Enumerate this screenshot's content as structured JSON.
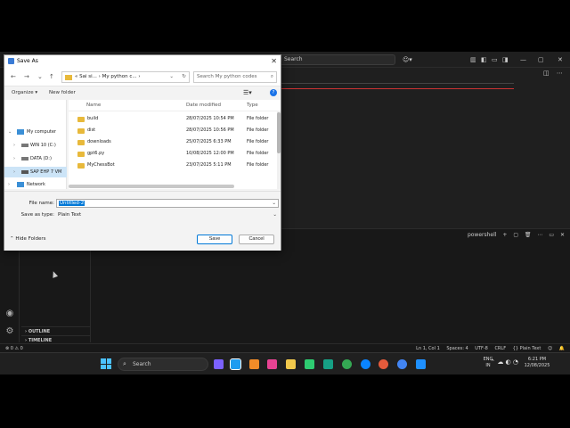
{
  "vscode": {
    "search_placeholder": "Search",
    "sections": {
      "outline": "OUTLINE",
      "timeline": "TIMELINE"
    },
    "panel_tabs": [
      "powershell",
      "+",
      "▢",
      "🗑",
      "⋯",
      "▭",
      "✕"
    ],
    "status_left": "⊗ 0 ⚠ 0",
    "status_right": [
      "Ln 1, Col 1",
      "Spaces: 4",
      "UTF-8",
      "CRLF",
      "{} Plain Text",
      "☺",
      "🔔"
    ]
  },
  "dialog": {
    "title": "Save As",
    "address_path": "« Sai si...  ›  My python c...  ›",
    "search_placeholder": "Search My python codes",
    "organize_label": "Organize ▾",
    "new_folder_label": "New folder",
    "nav_items": [
      {
        "label": "My computer",
        "expanded": true
      },
      {
        "label": "WIN 10 (C:)"
      },
      {
        "label": "DATA (D:)"
      },
      {
        "label": "SAP EHP 7 VM",
        "selected": true
      },
      {
        "label": "Network"
      }
    ],
    "columns": {
      "name": "Name",
      "date": "Date modified",
      "type": "Type"
    },
    "files": [
      {
        "name": "build",
        "date": "28/07/2025 10:54 PM",
        "type": "File folder",
        "kind": "folder"
      },
      {
        "name": "dist",
        "date": "28/07/2025 10:56 PM",
        "type": "File folder",
        "kind": "folder"
      },
      {
        "name": "downloads",
        "date": "25/07/2025 6:33 PM",
        "type": "File folder",
        "kind": "folder"
      },
      {
        "name": "gpt6.py",
        "date": "10/08/2025 12:00 PM",
        "type": "File folder",
        "kind": "folder"
      },
      {
        "name": "MyChessBot",
        "date": "23/07/2025 5:11 PM",
        "type": "File folder",
        "kind": "folder"
      }
    ],
    "file_name_label": "File name:",
    "file_name_value": "Untitled-2",
    "save_as_type_label": "Save as type:",
    "save_as_type_value": "Plain Text",
    "hide_folders_label": "Hide Folders",
    "save_label": "Save",
    "cancel_label": "Cancel"
  },
  "taskbar": {
    "search_placeholder": "Search",
    "lang_line1": "ENG",
    "lang_line2": "IN",
    "time": "6:21 PM",
    "date": "12/08/2025"
  },
  "colors": {
    "accent": "#0078d7",
    "folder": "#e8b93b",
    "vscode_bg": "#181818"
  }
}
